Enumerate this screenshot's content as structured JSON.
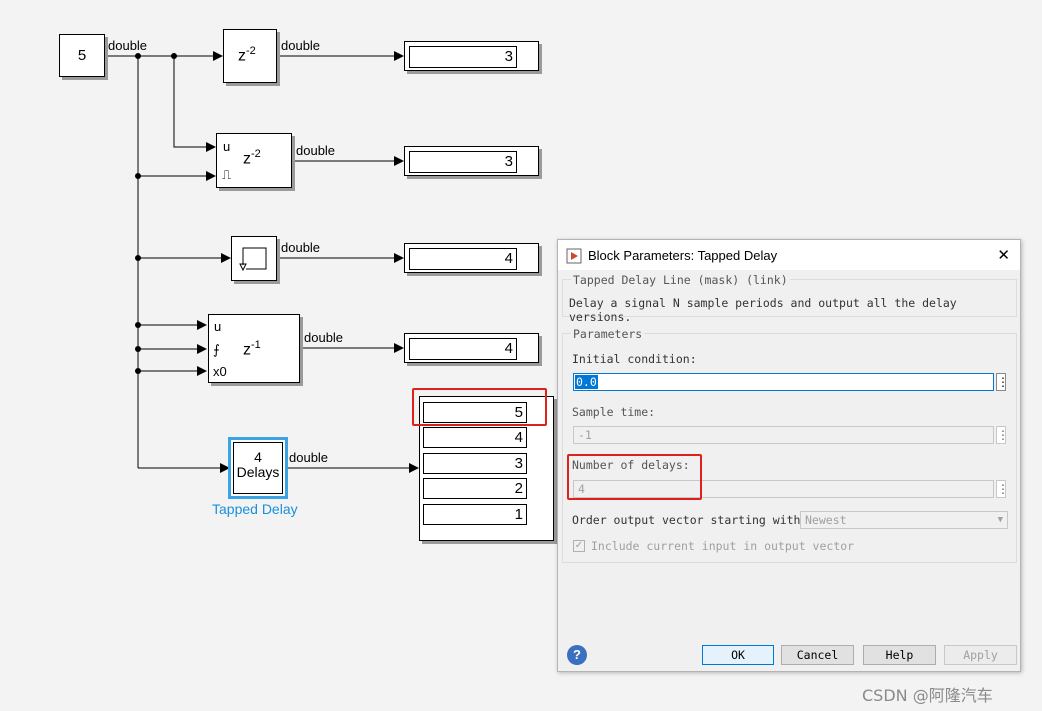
{
  "model": {
    "constant": {
      "value": "5",
      "out_type": "double"
    },
    "blocks": [
      {
        "name": "delay-z2",
        "text": "z",
        "exp": "-2",
        "out_type": "double",
        "display": "3"
      },
      {
        "name": "enabled-delay",
        "text": "z",
        "exp": "-2",
        "port_u": "u",
        "port_enable": "⎍",
        "out_type": "double",
        "display": "3"
      },
      {
        "name": "memory",
        "out_type": "double",
        "display": "4"
      },
      {
        "name": "resettable-delay",
        "text": "z",
        "exp": "-1",
        "port_u": "u",
        "port_reset": "⨍",
        "port_x0": "x0",
        "out_type": "double",
        "display": "4"
      }
    ],
    "tapped_delay": {
      "count": "4",
      "label": "Delays",
      "out_type": "double",
      "caption": "Tapped Delay",
      "outputs": [
        "5",
        "4",
        "3",
        "2",
        "1"
      ]
    }
  },
  "dialog": {
    "title": "Block Parameters: Tapped Delay",
    "close": "✕",
    "mask_header": "Tapped Delay Line (mask) (link)",
    "description": "Delay a signal N sample periods and output all the delay versions.",
    "params_header": "Parameters",
    "initial_condition_label": "Initial condition:",
    "initial_condition_value": "0.0",
    "sample_time_label": "Sample time:",
    "sample_time_value": "-1",
    "num_delays_label": "Number of delays:",
    "num_delays_value": "4",
    "order_label": "Order output vector starting with:",
    "order_value": "Newest",
    "include_current_label": "Include current input in output vector",
    "include_current_checked": true,
    "buttons": {
      "ok": "OK",
      "cancel": "Cancel",
      "help": "Help",
      "apply": "Apply"
    },
    "help_icon": "?"
  },
  "watermark": "CSDN @阿隆汽车",
  "colors": {
    "accent": "#0078d7",
    "highlight": "#e0201b",
    "selected_block": "#3aa3e3"
  }
}
